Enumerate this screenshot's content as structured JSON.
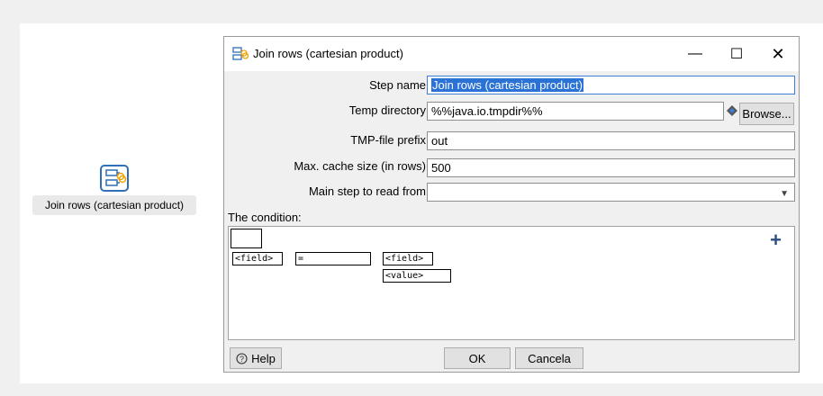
{
  "canvas": {
    "step_label": "Join rows (cartesian product)",
    "step_icon": "join-rows-step-icon"
  },
  "dialog": {
    "title": "Join rows (cartesian product)",
    "window_controls": {
      "minimize": "—",
      "maximize": "☐",
      "close": "✕"
    },
    "fields": {
      "step_name": {
        "label": "Step name",
        "value": "Join rows (cartesian product)"
      },
      "temp_directory": {
        "label": "Temp directory",
        "value": "%%java.io.tmpdir%%"
      },
      "tmp_file_prefix": {
        "label": "TMP-file prefix",
        "value": "out"
      },
      "max_cache_size": {
        "label": "Max. cache size (in rows)",
        "value": "500"
      },
      "main_step": {
        "label": "Main step to read from",
        "value": ""
      }
    },
    "browse_label": "Browse...",
    "condition": {
      "label": "The condition:",
      "left_field": "<field>",
      "operator": "=",
      "right_field": "<field>",
      "right_value": "<value>",
      "add_symbol": "+"
    },
    "buttons": {
      "help": "Help",
      "ok": "OK",
      "cancel": "Cancela"
    }
  },
  "colors": {
    "selection": "#2b72d6",
    "focus_border": "#3c7fd6",
    "step_icon_accent": "#2f6fb8",
    "join_accent": "#f0a400"
  }
}
